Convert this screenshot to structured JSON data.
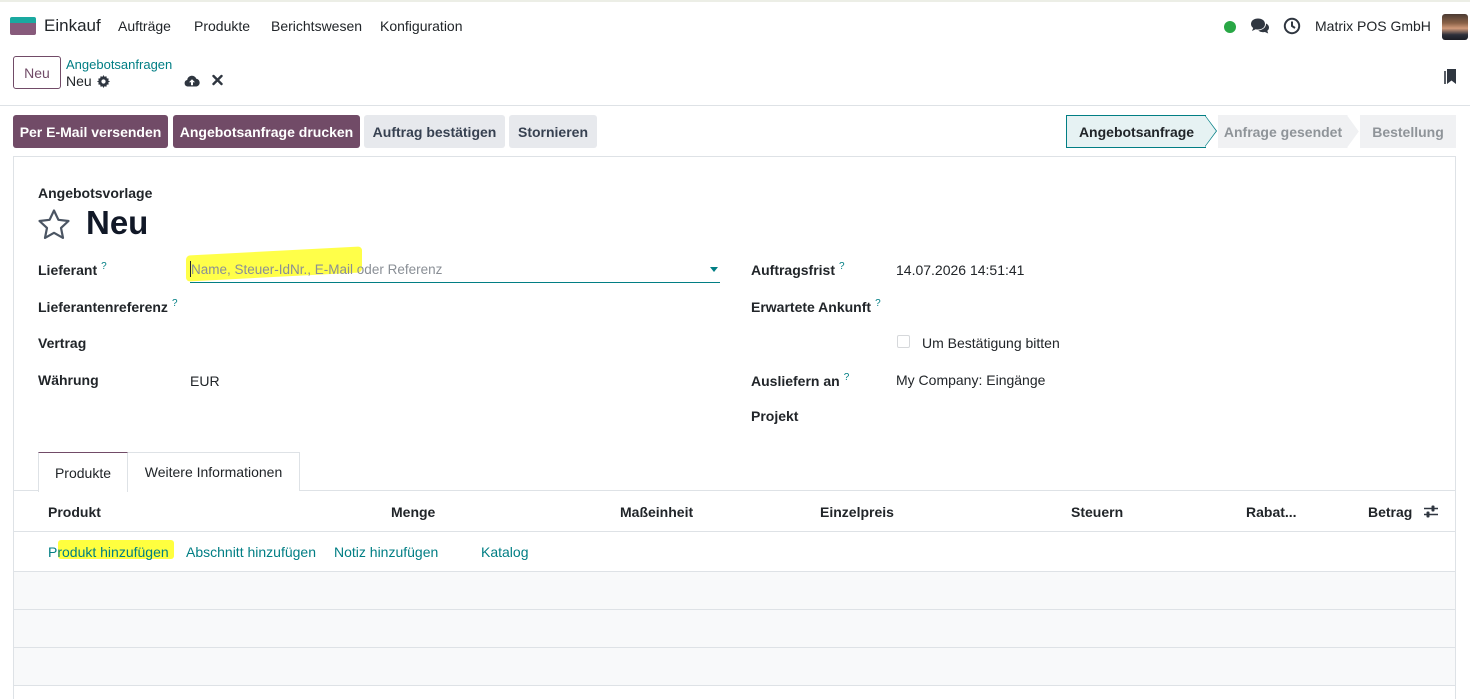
{
  "navbar": {
    "app_name": "Einkauf",
    "menu": [
      "Aufträge",
      "Produkte",
      "Berichtswesen",
      "Konfiguration"
    ],
    "company": "Matrix POS GmbH",
    "status_color": "#28a745"
  },
  "control_panel": {
    "new_button": "Neu",
    "breadcrumb_parent": "Angebotsanfragen",
    "breadcrumb_current": "Neu"
  },
  "actions": {
    "email": "Per E-Mail versenden",
    "print": "Angebotsanfrage drucken",
    "confirm": "Auftrag bestätigen",
    "cancel": "Stornieren"
  },
  "stages": [
    "Angebotsanfrage",
    "Anfrage gesendet",
    "Bestellung"
  ],
  "form": {
    "template_label": "Angebotsvorlage",
    "title": "Neu",
    "vendor_label": "Lieferant",
    "vendor_placeholder": "Name, Steuer-IdNr., E-Mail oder Referenz",
    "vendor_ref_label": "Lieferantenreferenz",
    "contract_label": "Vertrag",
    "currency_label": "Währung",
    "currency_value": "EUR",
    "deadline_label": "Auftragsfrist",
    "deadline_value": "14.07.2026 14:51:41",
    "expected_label": "Erwartete Ankunft",
    "confirm_checkbox_label": "Um Bestätigung bitten",
    "deliver_to_label": "Ausliefern an",
    "deliver_to_value": "My Company: Eingänge",
    "project_label": "Projekt",
    "help_mark": "?"
  },
  "tabs": [
    "Produkte",
    "Weitere Informationen"
  ],
  "table": {
    "columns": [
      "Produkt",
      "Menge",
      "Maßeinheit",
      "Einzelpreis",
      "Steuern",
      "Rabat...",
      "Betrag"
    ],
    "add_links": [
      "Produkt hinzufügen",
      "Abschnitt hinzufügen",
      "Notiz hinzufügen",
      "Katalog"
    ]
  },
  "colors": {
    "primary": "#714b67",
    "link": "#017e84",
    "highlight": "#ffff3f"
  }
}
